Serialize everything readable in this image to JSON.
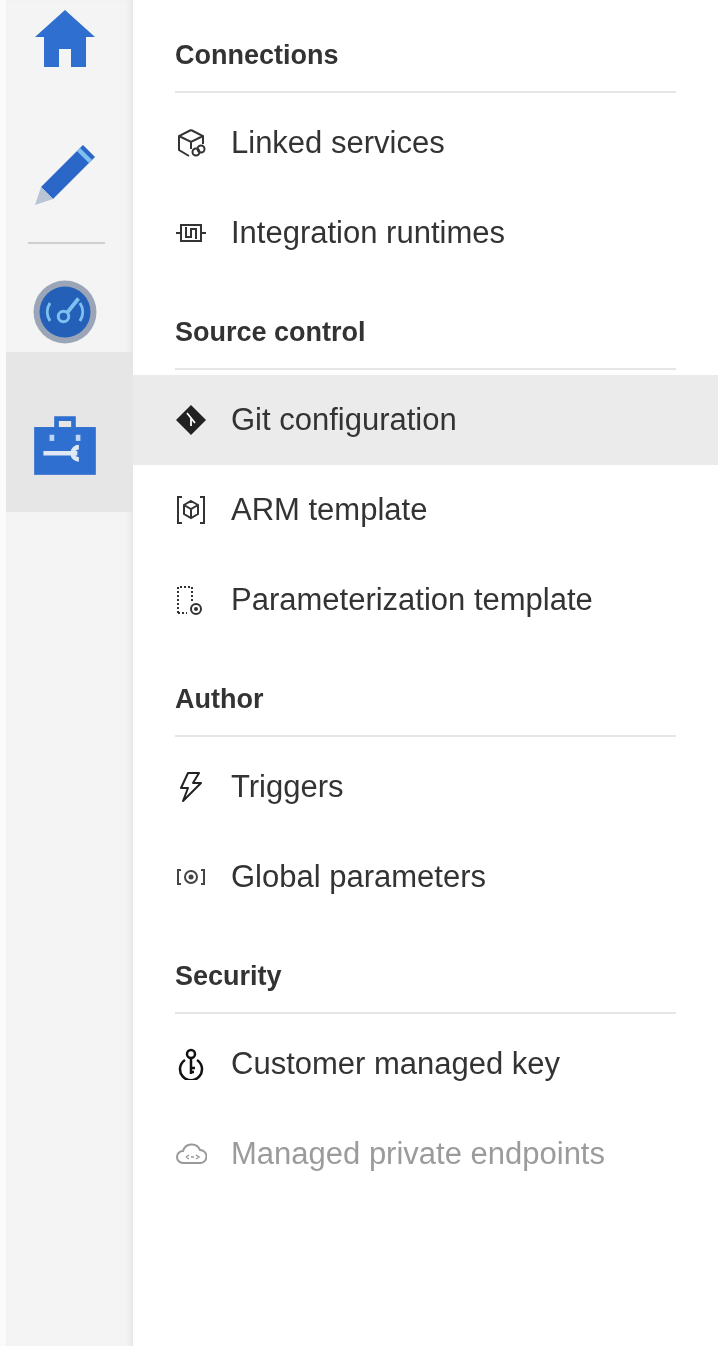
{
  "rail": {
    "items": [
      {
        "kind": "home",
        "selected": false
      },
      {
        "kind": "author",
        "selected": false
      },
      {
        "kind": "divider"
      },
      {
        "kind": "monitor",
        "selected": false
      },
      {
        "kind": "manage",
        "selected": true
      }
    ]
  },
  "sections": [
    {
      "title": "Connections",
      "items": [
        {
          "kind": "linked",
          "label": "Linked services",
          "selected": false,
          "disabled": false
        },
        {
          "kind": "runtime",
          "label": "Integration runtimes",
          "selected": false,
          "disabled": false
        }
      ]
    },
    {
      "title": "Source control",
      "items": [
        {
          "kind": "git",
          "label": "Git configuration",
          "selected": true,
          "disabled": false
        },
        {
          "kind": "arm",
          "label": "ARM template",
          "selected": false,
          "disabled": false
        },
        {
          "kind": "param",
          "label": "Parameterization template",
          "selected": false,
          "disabled": false
        }
      ]
    },
    {
      "title": "Author",
      "items": [
        {
          "kind": "trigger",
          "label": "Triggers",
          "selected": false,
          "disabled": false
        },
        {
          "kind": "global",
          "label": "Global parameters",
          "selected": false,
          "disabled": false
        }
      ]
    },
    {
      "title": "Security",
      "items": [
        {
          "kind": "key",
          "label": "Customer managed key",
          "selected": false,
          "disabled": false
        },
        {
          "kind": "endpoint",
          "label": "Managed private endpoints",
          "selected": false,
          "disabled": true
        }
      ]
    }
  ]
}
